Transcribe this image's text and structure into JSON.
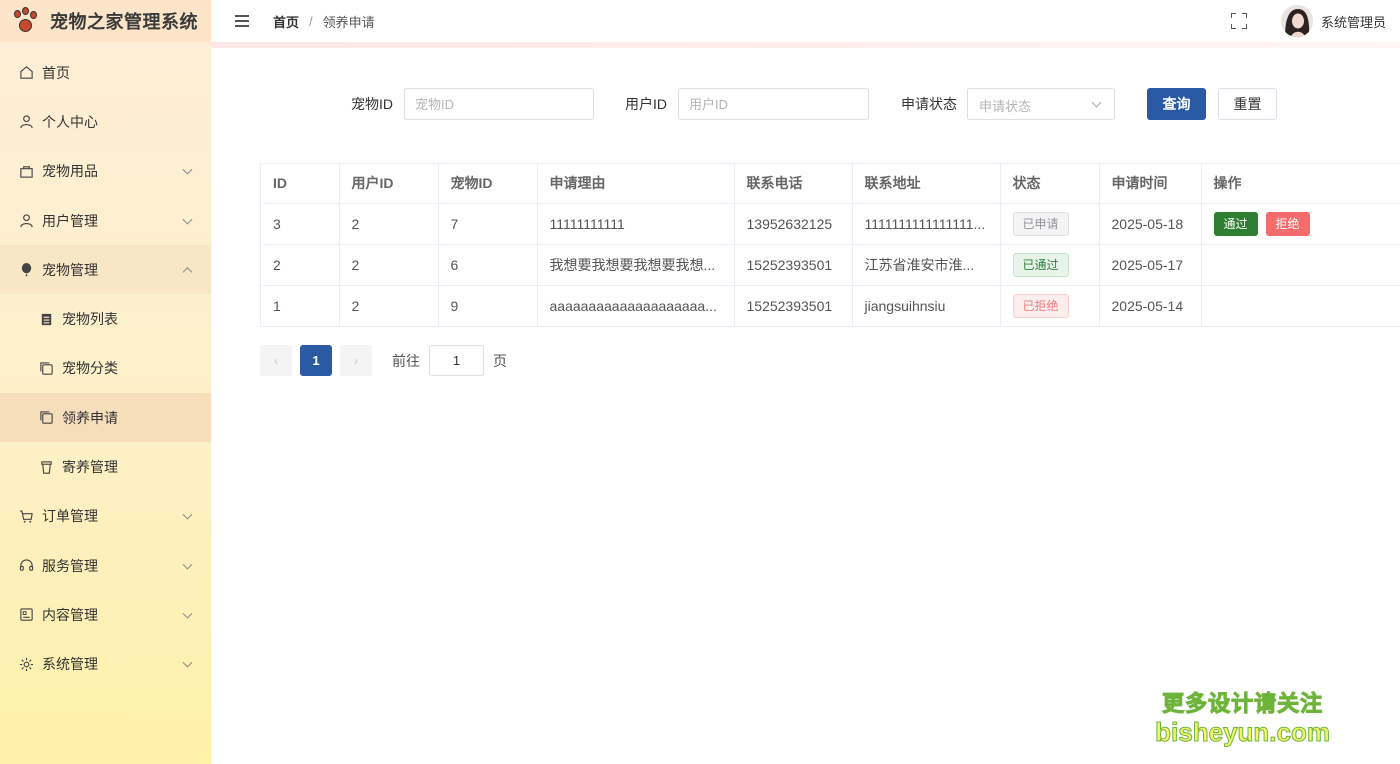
{
  "app": {
    "title": "宠物之家管理系统"
  },
  "sidebar": {
    "items": [
      {
        "label": "首页",
        "icon": "home-icon"
      },
      {
        "label": "个人中心",
        "icon": "user-icon"
      },
      {
        "label": "宠物用品",
        "icon": "bag-icon"
      },
      {
        "label": "用户管理",
        "icon": "user-icon"
      },
      {
        "label": "宠物管理",
        "icon": "balloon-icon"
      },
      {
        "label": "宠物列表",
        "icon": "list-icon"
      },
      {
        "label": "宠物分类",
        "icon": "copy-icon"
      },
      {
        "label": "领养申请",
        "icon": "copy-icon"
      },
      {
        "label": "寄养管理",
        "icon": "cup-icon"
      },
      {
        "label": "订单管理",
        "icon": "cart-icon"
      },
      {
        "label": "服务管理",
        "icon": "headset-icon"
      },
      {
        "label": "内容管理",
        "icon": "document-icon"
      },
      {
        "label": "系统管理",
        "icon": "gear-icon"
      }
    ]
  },
  "header": {
    "breadcrumb_home": "首页",
    "breadcrumb_separator": "/",
    "breadcrumb_current": "领养申请",
    "admin_name": "系统管理员"
  },
  "search": {
    "pet_id_label": "宠物ID",
    "pet_id_placeholder": "宠物ID",
    "user_id_label": "用户ID",
    "user_id_placeholder": "用户ID",
    "status_label": "申请状态",
    "status_placeholder": "申请状态",
    "query_button": "查询",
    "reset_button": "重置"
  },
  "table": {
    "columns": [
      "ID",
      "用户ID",
      "宠物ID",
      "申请理由",
      "联系电话",
      "联系地址",
      "状态",
      "申请时间",
      "操作"
    ],
    "rows": [
      {
        "id": "3",
        "user_id": "2",
        "pet_id": "7",
        "reason": "11111111111",
        "phone": "13952632125",
        "address": "1111111111111111...",
        "status": "已申请",
        "time": "2025-05-18"
      },
      {
        "id": "2",
        "user_id": "2",
        "pet_id": "6",
        "reason": "我想要我想要我想要我想...",
        "phone": "15252393501",
        "address": "江苏省淮安市淮...",
        "status": "已通过",
        "time": "2025-05-17"
      },
      {
        "id": "1",
        "user_id": "2",
        "pet_id": "9",
        "reason": "aaaaaaaaaaaaaaaaaaaa...",
        "phone": "15252393501",
        "address": "jiangsuihnsiu",
        "status": "已拒绝",
        "time": "2025-05-14"
      }
    ],
    "actions": {
      "approve": "通过",
      "reject": "拒绝"
    }
  },
  "pagination": {
    "current_page": "1",
    "goto_label": "前往",
    "goto_value": "1",
    "page_suffix": "页",
    "prev_symbol": "‹",
    "next_symbol": "›"
  },
  "watermark": {
    "line1": "更多设计请关注",
    "line2": "bisheyun.com"
  },
  "colors": {
    "primary": "#2b5aa5",
    "approve": "#2e7d32",
    "reject": "#f56c6c"
  }
}
